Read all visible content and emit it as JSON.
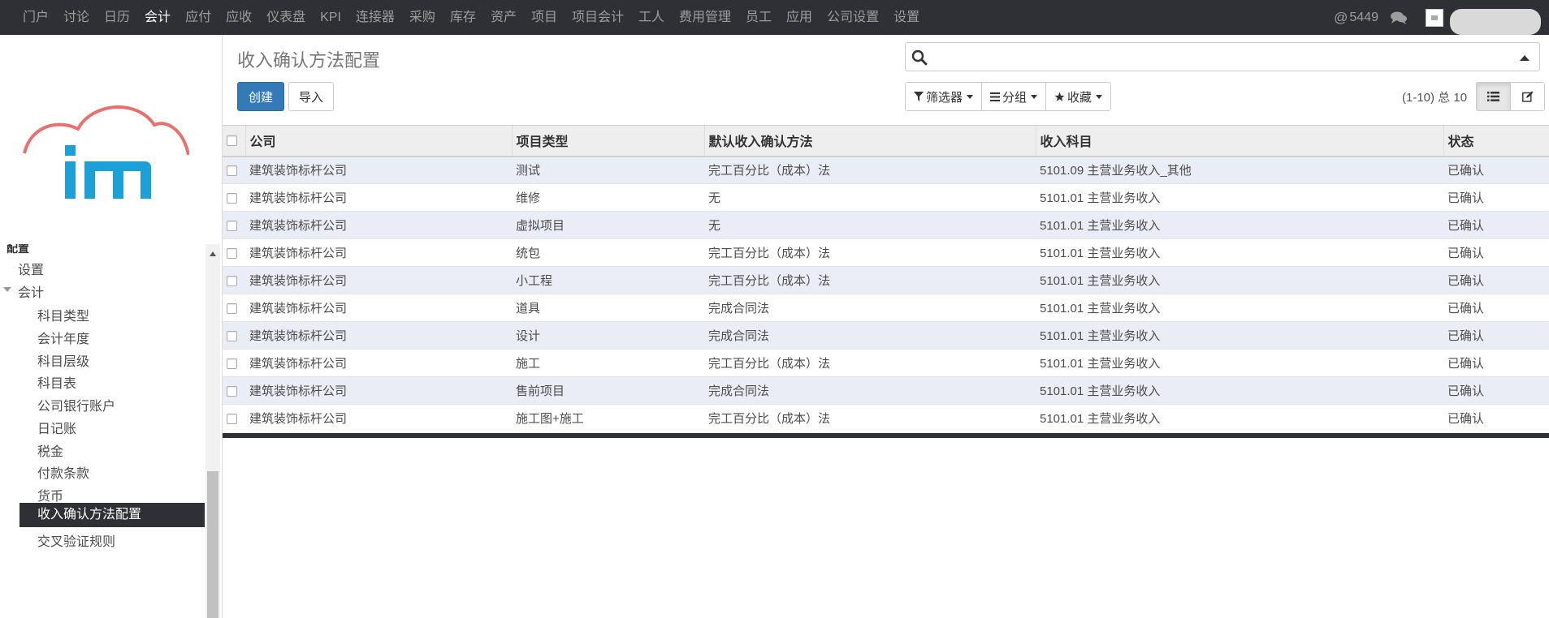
{
  "topnav": {
    "items": [
      "门户",
      "讨论",
      "日历",
      "会计",
      "应付",
      "应收",
      "仪表盘",
      "KPI",
      "连接器",
      "采购",
      "库存",
      "资产",
      "项目",
      "项目会计",
      "工人",
      "费用管理",
      "员工",
      "应用",
      "公司设置",
      "设置"
    ],
    "active_index": 3,
    "message_count": "5449"
  },
  "sidebar": {
    "cut_header": "配置",
    "items": [
      {
        "label": "设置",
        "level": 1
      },
      {
        "label": "会计",
        "level": 1,
        "expanded": true
      },
      {
        "label": "科目类型",
        "level": 2
      },
      {
        "label": "会计年度",
        "level": 2
      },
      {
        "label": "科目层级",
        "level": 2
      },
      {
        "label": "科目表",
        "level": 2
      },
      {
        "label": "公司银行账户",
        "level": 2
      },
      {
        "label": "日记账",
        "level": 2
      },
      {
        "label": "税金",
        "level": 2
      },
      {
        "label": "付款条款",
        "level": 2
      },
      {
        "label": "货币",
        "level": 2
      },
      {
        "label": "收入确认方法配置",
        "level": 2,
        "active": true
      },
      {
        "label": "交叉验证规则",
        "level": 2
      }
    ]
  },
  "main": {
    "title": "收入确认方法配置",
    "create_label": "创建",
    "import_label": "导入",
    "search_placeholder": "",
    "filters_label": "筛选器",
    "group_label": "分组",
    "favorites_label": "收藏",
    "pager": "(1-10) 总 10"
  },
  "table": {
    "columns": [
      "公司",
      "项目类型",
      "默认收入确认方法",
      "收入科目",
      "状态"
    ],
    "rows": [
      [
        "建筑装饰标杆公司",
        "测试",
        "完工百分比（成本）法",
        "5101.09 主营业务收入_其他",
        "已确认"
      ],
      [
        "建筑装饰标杆公司",
        "维修",
        "无",
        "5101.01 主营业务收入",
        "已确认"
      ],
      [
        "建筑装饰标杆公司",
        "虚拟项目",
        "无",
        "5101.01 主营业务收入",
        "已确认"
      ],
      [
        "建筑装饰标杆公司",
        "统包",
        "完工百分比（成本）法",
        "5101.01 主营业务收入",
        "已确认"
      ],
      [
        "建筑装饰标杆公司",
        "小工程",
        "完工百分比（成本）法",
        "5101.01 主营业务收入",
        "已确认"
      ],
      [
        "建筑装饰标杆公司",
        "道具",
        "完成合同法",
        "5101.01 主营业务收入",
        "已确认"
      ],
      [
        "建筑装饰标杆公司",
        "设计",
        "完成合同法",
        "5101.01 主营业务收入",
        "已确认"
      ],
      [
        "建筑装饰标杆公司",
        "施工",
        "完工百分比（成本）法",
        "5101.01 主营业务收入",
        "已确认"
      ],
      [
        "建筑装饰标杆公司",
        "售前项目",
        "完成合同法",
        "5101.01 主营业务收入",
        "已确认"
      ],
      [
        "建筑装饰标杆公司",
        "施工图+施工",
        "完工百分比（成本）法",
        "5101.01 主营业务收入",
        "已确认"
      ]
    ]
  },
  "colors": {
    "navbar": "#2f3033",
    "primary": "#337ab7",
    "row_alt": "#ebedf6",
    "logo_arc": "#e8716f",
    "logo_text": "#1ba0d8"
  }
}
